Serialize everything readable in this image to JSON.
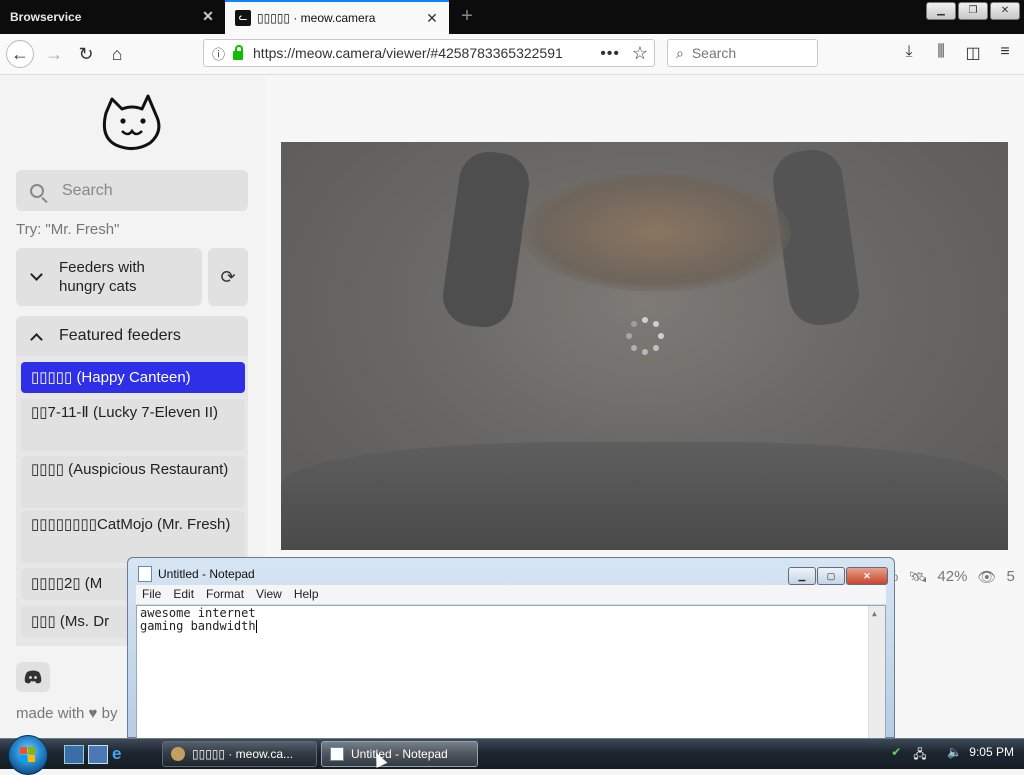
{
  "browser": {
    "tabs": [
      {
        "label": "Browservice",
        "active": false
      },
      {
        "label": "▯▯▯▯▯ · meow.camera",
        "active": true
      }
    ],
    "new_tab_label": "+",
    "url": "https://meow.camera/viewer/#4258783365322591",
    "search_placeholder": "Search",
    "accent_color": "#0a84ff"
  },
  "sidebar": {
    "search_placeholder": "Search",
    "hint": "Try: \"Mr. Fresh\"",
    "hungry_section": "Feeders with hungry cats",
    "featured_section": "Featured feeders",
    "feeders": [
      {
        "label": "▯▯▯▯▯ (Happy Canteen)",
        "active": true
      },
      {
        "label": "▯▯7-11-Ⅱ (Lucky 7-Eleven II)",
        "active": false
      },
      {
        "label": "▯▯▯▯ (Auspicious Restaurant)",
        "active": false
      },
      {
        "label": "▯▯▯▯▯▯▯▯CatMojo (Mr. Fresh)",
        "active": false
      },
      {
        "label": "▯▯▯▯2▯ (M",
        "active": false
      },
      {
        "label": "▯▯▯ (Ms. Dr",
        "active": false
      }
    ],
    "footer": "made with ♥ by"
  },
  "viewer": {
    "stats": {
      "first": "%",
      "second": "42%",
      "third": "5"
    }
  },
  "notepad": {
    "title": "Untitled - Notepad",
    "menu": [
      "File",
      "Edit",
      "Format",
      "View",
      "Help"
    ],
    "lines": [
      "awesome internet",
      "gaming bandwidth"
    ]
  },
  "taskbar": {
    "items": [
      {
        "label": "▯▯▯▯▯ · meow.ca...",
        "active": false
      },
      {
        "label": "Untitled - Notepad",
        "active": true
      }
    ],
    "clock": "9:05 PM"
  }
}
